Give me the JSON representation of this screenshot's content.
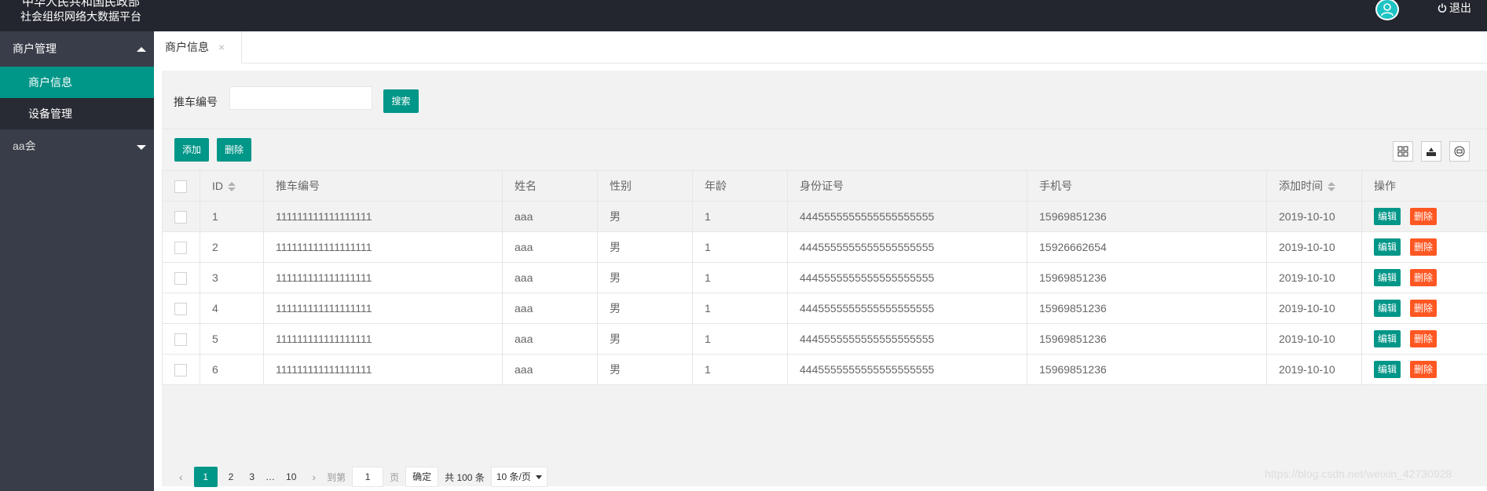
{
  "header": {
    "title_line1": "中华人民共和国民政部",
    "title_line2": "社会组织网络大数据平台",
    "logout_label": "退出",
    "avatar_icon": "user-icon",
    "logout_icon": "power-icon"
  },
  "sidebar": {
    "groups": [
      {
        "label": "商户管理",
        "expanded": true,
        "items": [
          {
            "label": "商户信息",
            "active": true
          },
          {
            "label": "设备管理",
            "active": false
          }
        ]
      },
      {
        "label": "aa会",
        "expanded": false
      }
    ]
  },
  "tabs": [
    {
      "label": "商户信息",
      "close": "×"
    }
  ],
  "search": {
    "label": "推车编号",
    "value": "",
    "button": "搜索"
  },
  "toolbar": {
    "add": "添加",
    "delete": "删除",
    "icons": [
      "columns-icon",
      "export-icon",
      "print-icon"
    ]
  },
  "table": {
    "columns": [
      "",
      "ID",
      "推车编号",
      "姓名",
      "性别",
      "年龄",
      "身份证号",
      "手机号",
      "添加时间",
      "操作"
    ],
    "rows": [
      {
        "id": "1",
        "cart": "111111111111111111",
        "name": "aaa",
        "gender": "男",
        "age": "1",
        "idcard": "4445555555555555555555",
        "phone": "15969851236",
        "time": "2019-10-10"
      },
      {
        "id": "2",
        "cart": "111111111111111111",
        "name": "aaa",
        "gender": "男",
        "age": "1",
        "idcard": "4445555555555555555555",
        "phone": "15926662654",
        "time": "2019-10-10"
      },
      {
        "id": "3",
        "cart": "111111111111111111",
        "name": "aaa",
        "gender": "男",
        "age": "1",
        "idcard": "4445555555555555555555",
        "phone": "15969851236",
        "time": "2019-10-10"
      },
      {
        "id": "4",
        "cart": "111111111111111111",
        "name": "aaa",
        "gender": "男",
        "age": "1",
        "idcard": "4445555555555555555555",
        "phone": "15969851236",
        "time": "2019-10-10"
      },
      {
        "id": "5",
        "cart": "111111111111111111",
        "name": "aaa",
        "gender": "男",
        "age": "1",
        "idcard": "4445555555555555555555",
        "phone": "15969851236",
        "time": "2019-10-10"
      },
      {
        "id": "6",
        "cart": "111111111111111111",
        "name": "aaa",
        "gender": "男",
        "age": "1",
        "idcard": "4445555555555555555555",
        "phone": "15969851236",
        "time": "2019-10-10"
      }
    ],
    "edit_label": "编辑",
    "delete_label": "删除"
  },
  "pager": {
    "prev": "‹",
    "pages": [
      "1",
      "2",
      "3"
    ],
    "ellipsis": "…",
    "last": "10",
    "next": "›",
    "goto_label": "到第",
    "goto_value": "1",
    "page_unit": "页",
    "confirm": "确定",
    "total": "共 100 条",
    "limit": "10 条/页"
  },
  "watermark": "https://blog.csdn.net/weixin_42730928",
  "colors": {
    "primary": "#009688",
    "danger": "#ff5722",
    "header_bg": "#23262e",
    "sidebar_bg": "#393d49"
  }
}
